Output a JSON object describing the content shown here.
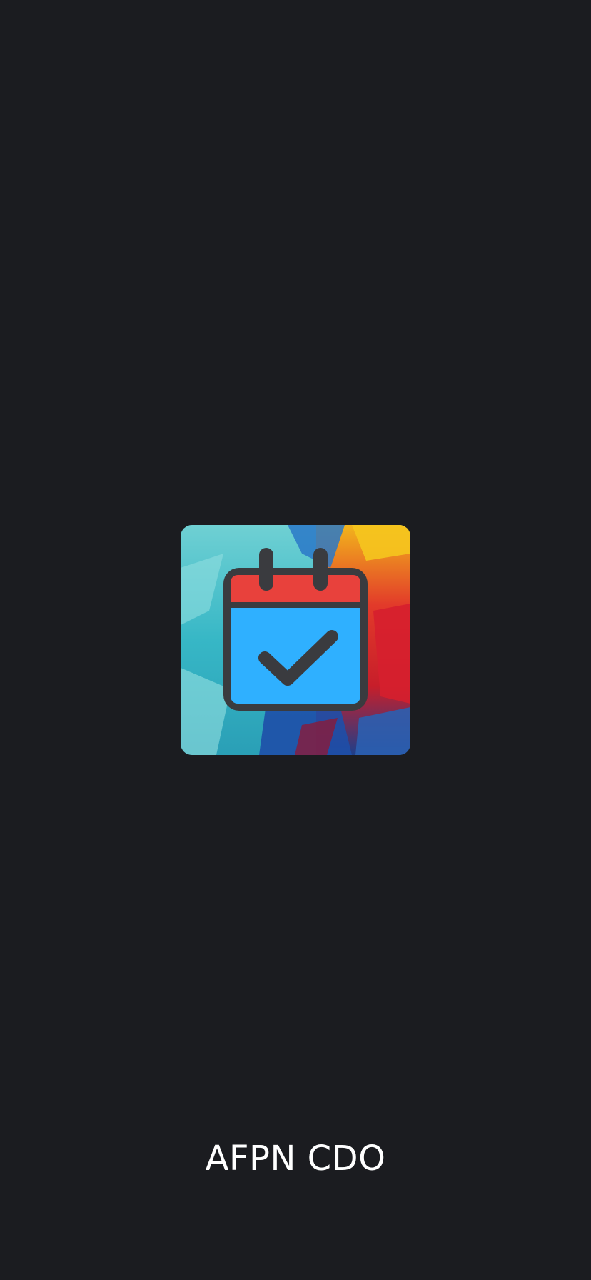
{
  "screen": {
    "background_color": "#1b1c20"
  },
  "app_icon": {
    "icon_name": "calendar-check-icon",
    "calendar_header_color": "#e8413c",
    "calendar_body_color": "#2fb0ff",
    "outline_color": "#3a3b3f"
  },
  "app_name": "AFPN CDO"
}
